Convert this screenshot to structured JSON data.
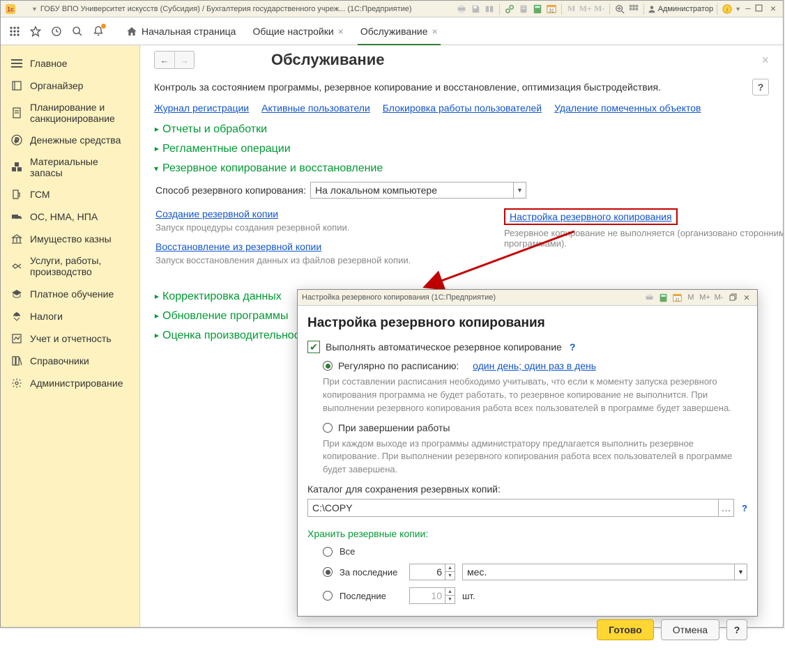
{
  "titlebar": {
    "title": "ГОБУ ВПО Университет искусств (Субсидия) / Бухгалтерия государственного учреж...  (1С:Предприятие)",
    "user_label": "Администратор",
    "m_labels": [
      "M",
      "M+",
      "M-"
    ]
  },
  "tabs": {
    "home": "Начальная страница",
    "t1": "Общие настройки",
    "t2": "Обслуживание"
  },
  "sidebar": {
    "items": [
      {
        "label": "Главное"
      },
      {
        "label": "Органайзер"
      },
      {
        "label": "Планирование и санкционирование"
      },
      {
        "label": "Денежные средства"
      },
      {
        "label": "Материальные запасы"
      },
      {
        "label": "ГСМ"
      },
      {
        "label": "ОС, НМА, НПА"
      },
      {
        "label": "Имущество казны"
      },
      {
        "label": "Услуги, работы, производство"
      },
      {
        "label": "Платное обучение"
      },
      {
        "label": "Налоги"
      },
      {
        "label": "Учет и отчетность"
      },
      {
        "label": "Справочники"
      },
      {
        "label": "Администрирование"
      }
    ]
  },
  "page": {
    "title": "Обслуживание",
    "subtitle": "Контроль за состоянием программы, резервное копирование и восстановление, оптимизация быстродействия.",
    "help": "?",
    "links": [
      "Журнал регистрации",
      "Активные пользователи",
      "Блокировка работы пользователей",
      "Удаление помеченных объектов"
    ],
    "sect1": "Отчеты и обработки",
    "sect2": "Регламентные операции",
    "sect3": "Резервное копирование и восстановление",
    "backup_method_label": "Способ резервного копирования:",
    "backup_method_value": "На локальном компьютере",
    "create_backup": "Создание резервной копии",
    "create_backup_hint": "Запуск процедуры создания резервной копии.",
    "restore_backup": "Восстановление из резервной копии",
    "restore_backup_hint": "Запуск восстановления данных из файлов резервной копии.",
    "settings_backup": "Настройка резервного копирования",
    "settings_backup_hint": "Резервное копирование не выполняется (организовано сторонними программами).",
    "sect4": "Корректировка данных",
    "sect5": "Обновление программы",
    "sect6": "Оценка производительности"
  },
  "dialog": {
    "title": "Настройка резервного копирования  (1С:Предприятие)",
    "heading": "Настройка резервного копирования",
    "chk_label": "Выполнять автоматическое резервное копирование",
    "radio_schedule": "Регулярно по расписанию:",
    "schedule_link": "один день; один раз в день",
    "note1": "При составлении расписания необходимо учитывать, что если к моменту запуска резервного копирования программа не будет работать, то резервное копирование не выполнится. При выполнении резервного копирования работа всех пользователей в программе будет завершена.",
    "radio_onexit": "При завершении работы",
    "note2": "При каждом выходе из программы администратору предлагается выполнить резервное копирование. При выполнении резервного копирования работа всех пользователей в программе будет завершена.",
    "folder_label": "Каталог для сохранения резервных копий:",
    "folder_value": "C:\\COPY",
    "keep_label": "Хранить резервные копии:",
    "keep_all": "Все",
    "keep_last_period": "За последние",
    "keep_period_val": "6",
    "keep_period_unit": "мес.",
    "keep_last_n": "Последние",
    "keep_n_val": "10",
    "keep_n_unit": "шт.",
    "btn_ok": "Готово",
    "btn_cancel": "Отмена",
    "btn_help": "?",
    "m_labels": [
      "M",
      "M+",
      "M-"
    ]
  }
}
